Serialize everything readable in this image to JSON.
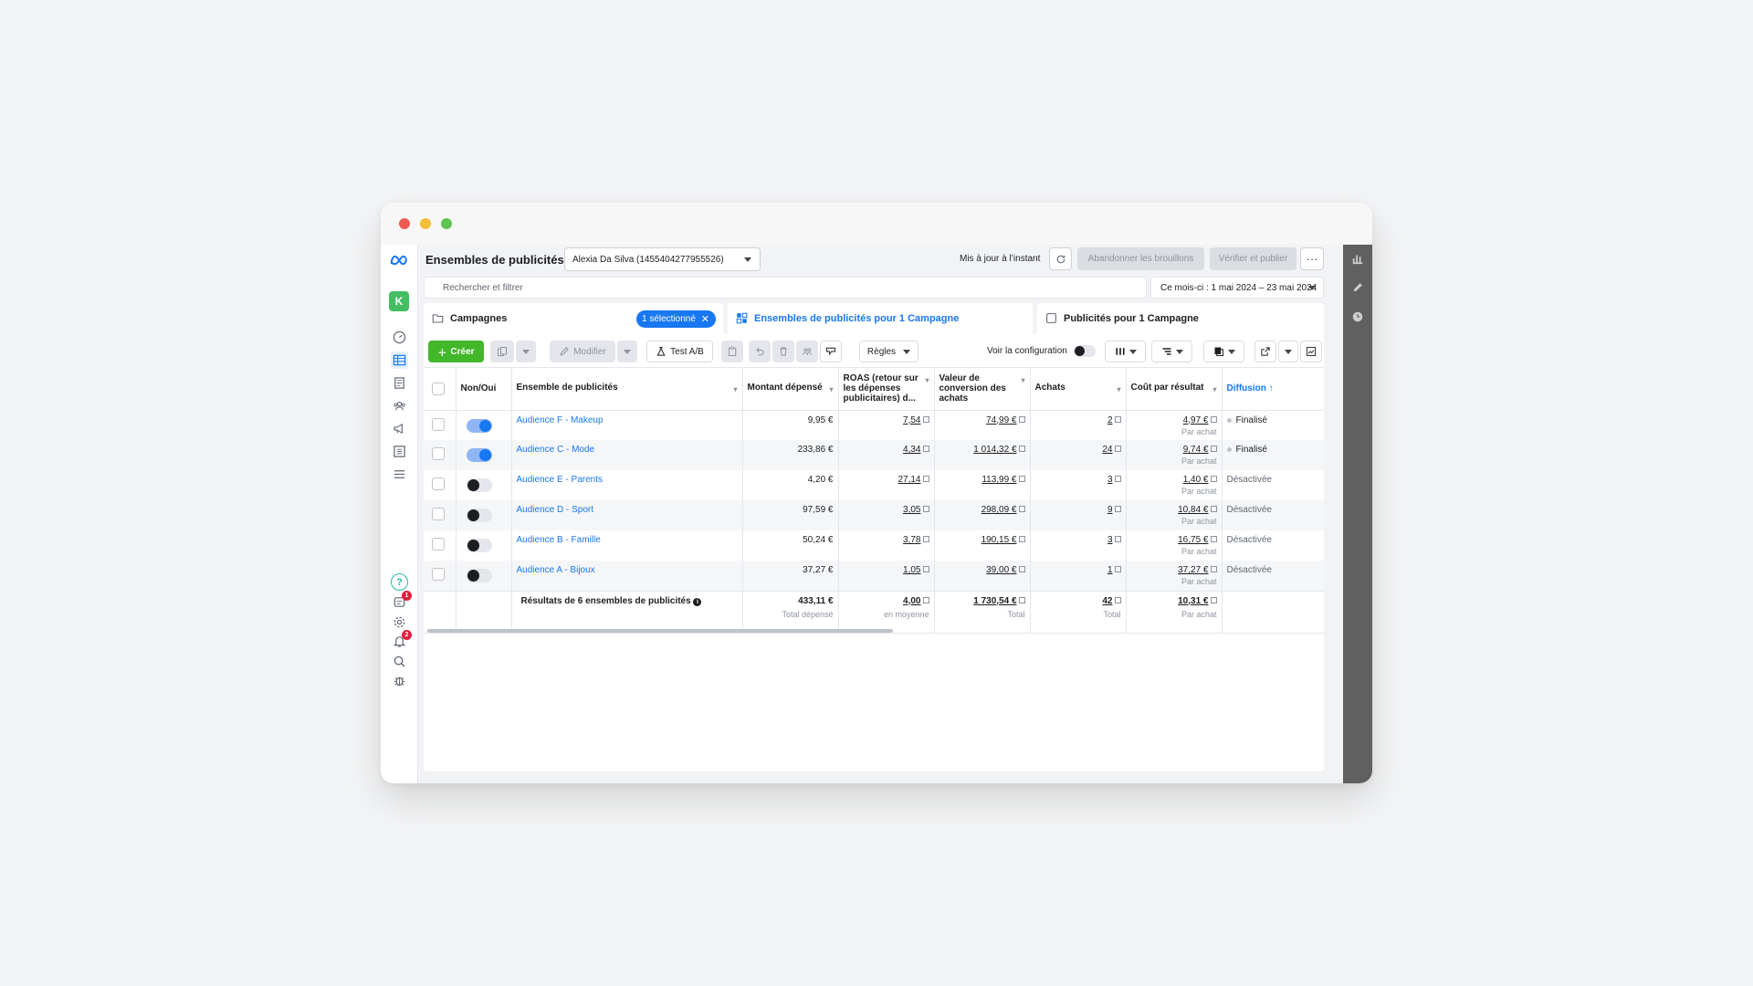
{
  "header": {
    "title": "Ensembles de publicités",
    "account": "Alexia Da Silva (1455404277955526)",
    "updated": "Mis à jour à l’instant",
    "discard_label": "Abandonner les brouillons",
    "publish_label": "Vérifier et publier",
    "more_label": "···"
  },
  "search": {
    "placeholder": "Rechercher et filtrer"
  },
  "date_range": "Ce mois-ci : 1 mai 2024 – 23 mai 2024",
  "sidebar": {
    "account_initial": "K",
    "help_label": "?",
    "alerts_count": "1",
    "notifications_count": "2"
  },
  "tabs": {
    "campaigns": "Campagnes",
    "selected": "1 sélectionné",
    "adsets": "Ensembles de publicités pour 1 Campagne",
    "ads": "Publicités pour 1 Campagne"
  },
  "toolbar": {
    "create": "Créer",
    "edit": "Modifier",
    "abtest": "Test A/B",
    "rules": "Règles",
    "setup_label": "Voir la configuration"
  },
  "table": {
    "headers": {
      "onoff": "Non/Oui",
      "adset": "Ensemble de publicités",
      "spent": "Montant dépensé",
      "roas": "ROAS (retour sur les dépenses publicitaires) d...",
      "value": "Valeur de conversion des achats",
      "purchases": "Achats",
      "cpr": "Coût par résultat",
      "delivery": "Diffusion ↑"
    },
    "rows": [
      {
        "name": "Audience F - Makeup",
        "on": true,
        "spent": "9,95 €",
        "roas": "7,54",
        "value": "74,99 €",
        "purchases": "2",
        "cpr": "4,97 €",
        "cpr_sub": "Par achat",
        "status": "Finalisé"
      },
      {
        "name": "Audience C - Mode",
        "on": true,
        "spent": "233,86 €",
        "roas": "4,34",
        "value": "1 014,32 €",
        "purchases": "24",
        "cpr": "9,74 €",
        "cpr_sub": "Par achat",
        "status": "Finalisé"
      },
      {
        "name": "Audience E - Parents",
        "on": false,
        "spent": "4,20 €",
        "roas": "27,14",
        "value": "113,99 €",
        "purchases": "3",
        "cpr": "1,40 €",
        "cpr_sub": "Par achat",
        "status": "Désactivée"
      },
      {
        "name": "Audience D - Sport",
        "on": false,
        "spent": "97,59 €",
        "roas": "3,05",
        "value": "298,09 €",
        "purchases": "9",
        "cpr": "10,84 €",
        "cpr_sub": "Par achat",
        "status": "Désactivée"
      },
      {
        "name": "Audience B - Famille",
        "on": false,
        "spent": "50,24 €",
        "roas": "3,78",
        "value": "190,15 €",
        "purchases": "3",
        "cpr": "16,75 €",
        "cpr_sub": "Par achat",
        "status": "Désactivée"
      },
      {
        "name": "Audience A - Bijoux",
        "on": false,
        "spent": "37,27 €",
        "roas": "1,05",
        "value": "39,00 €",
        "purchases": "1",
        "cpr": "37,27 €",
        "cpr_sub": "Par achat",
        "status": "Désactivée"
      }
    ],
    "total": {
      "label": "Résultats de 6 ensembles de publicités",
      "spent": "433,11 €",
      "spent_sub": "Total dépensé",
      "roas": "4,00",
      "roas_sub": "en moyenne",
      "value": "1 730,54 €",
      "value_sub": "Total",
      "purchases": "42",
      "purchases_sub": "Total",
      "cpr": "10,31 €",
      "cpr_sub": "Par achat"
    }
  },
  "colors": {
    "accent": "#1877f2",
    "create": "#42b72a"
  }
}
